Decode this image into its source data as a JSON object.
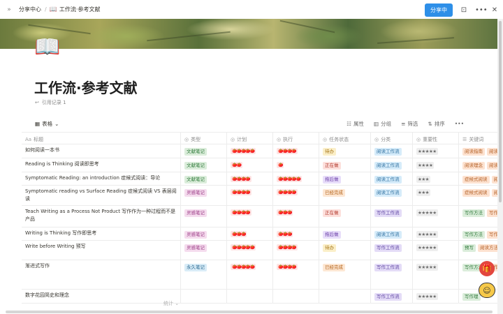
{
  "topbar": {
    "breadcrumb_home": "分享中心",
    "breadcrumb_sep": "/",
    "breadcrumb_page": "工作流·参考文献",
    "share_label": "分享中",
    "icons": [
      "expand-icon",
      "bookmark-icon",
      "more-icon",
      "close-icon"
    ]
  },
  "page": {
    "icon": "📖",
    "title": "工作流·参考文献",
    "backlinks": "引用记录 1"
  },
  "view": {
    "tab_label": "表格",
    "tools": {
      "properties": "属性",
      "group": "分组",
      "filter": "筛选",
      "sort": "排序"
    }
  },
  "columns": {
    "title": "标题",
    "type": "类型",
    "plan": "计划",
    "exec": "执行",
    "status": "任务状态",
    "category": "分类",
    "importance": "重要性",
    "keywords": "关键词"
  },
  "rows": [
    {
      "title": "如何阅读一本书",
      "type": "文献笔记",
      "plan": "🍅🍅🍅🍅🍅",
      "exec": "🍅🍅🍅🍅",
      "status": "待办",
      "category": "阅读工作流",
      "importance": "★★★★★",
      "kw1": "阅读指南",
      "kw2": "阅读"
    },
    {
      "title": "Reading is Thinking 阅读即思考",
      "type": "文献笔记",
      "plan": "🍅🍅",
      "exec": "🍅",
      "status": "正在做",
      "category": "阅读工作流",
      "importance": "★★★★",
      "kw1": "阅读理念",
      "kw2": "阅读"
    },
    {
      "title": "Symptomatic Reading: an introduction 症候式阅读：导论",
      "type": "文献笔记",
      "plan": "🍅🍅🍅🍅",
      "exec": "🍅🍅🍅🍅🍅",
      "status": "拖后做",
      "category": "阅读工作流",
      "importance": "★★★",
      "kw1": "症候式阅读",
      "kw2": "阅"
    },
    {
      "title": "Symptomatic reading vs Surface Reading 症候式阅读 VS 表层阅读",
      "type": "灵感笔记",
      "plan": "🍅🍅🍅🍅",
      "exec": "🍅🍅🍅🍅",
      "status": "已经完成",
      "category": "阅读工作流",
      "importance": "★★★",
      "kw1": "症候式阅读",
      "kw2": "阅"
    },
    {
      "title": "Teach Writing as a Process Not Product  写作作为一种过程而不是产品",
      "type": "灵感笔记",
      "plan": "🍅🍅🍅🍅",
      "exec": "🍅🍅🍅",
      "status": "正在做",
      "category": "写作工作流",
      "importance": "★★★★★",
      "kw1": "写作方法",
      "kw2": "写作"
    },
    {
      "title": "Writing is Thinking 写作即思考",
      "type": "灵感笔记",
      "plan": "🍅🍅🍅",
      "exec": "🍅🍅🍅",
      "status": "拖后做",
      "category": "阅读工作流",
      "importance": "★★★★★",
      "kw1": "写作方法",
      "kw2": "写作"
    },
    {
      "title": "Write before Writing  预写",
      "type": "灵感笔记",
      "plan": "🍅🍅🍅🍅🍅",
      "exec": "🍅🍅🍅🍅",
      "status": "待办",
      "category": "写作工作流",
      "importance": "★★★★★",
      "kw1": "预写",
      "kw2": "阅读方法"
    },
    {
      "title": "渐进式写作",
      "type": "永久笔记",
      "plan": "🍅🍅🍅🍅🍅",
      "exec": "🍅🍅🍅🍅",
      "status": "已经完成",
      "category": "写作工作流",
      "importance": "★★★★★",
      "kw1": "写作方法",
      "kw2": "写作"
    },
    {
      "title": "数字花园简史和理念",
      "type": "",
      "plan": "",
      "exec": "",
      "status": "",
      "category": "写作工作流",
      "importance": "★★★★★",
      "kw1": "写作理",
      "kw2": ""
    }
  ],
  "footer": {
    "count_label": "统计 ⌄"
  },
  "colors": {
    "share": "#2e8fe8",
    "tag_green_bg": "#dbeddb",
    "tag_green_fg": "#2f7a3a",
    "tag_pink_bg": "#f5dcee",
    "tag_pink_fg": "#9b3b86",
    "tag_blue_bg": "#d9ecf7",
    "tag_blue_fg": "#2c6b93",
    "status_todo_bg": "#fbefc8",
    "status_todo_fg": "#a7761a",
    "status_doing_bg": "#fde0dc",
    "status_doing_fg": "#b33a2e",
    "status_later_bg": "#e8defa",
    "status_later_fg": "#6b3fa8",
    "status_done_bg": "#fde7d3",
    "status_done_fg": "#b5651d",
    "cat_read_bg": "#d6ecfa",
    "cat_read_fg": "#2a6d9e",
    "cat_write_bg": "#e4dcf7",
    "cat_write_fg": "#5a3fa0"
  }
}
